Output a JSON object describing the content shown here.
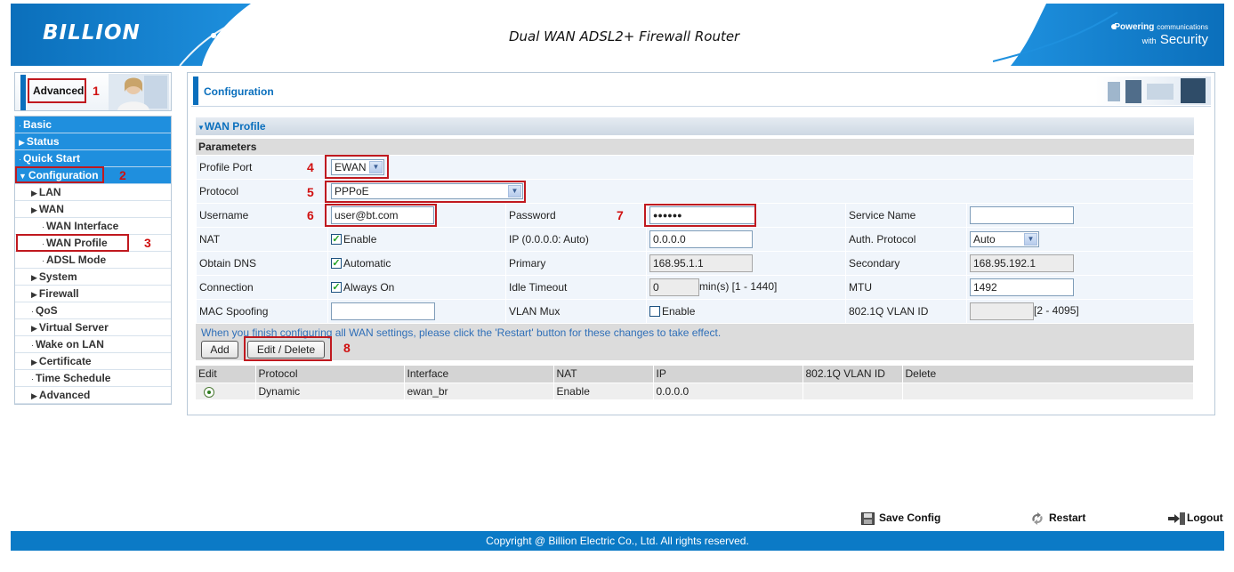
{
  "header": {
    "logo": "BILLION",
    "router_title": "Dual WAN ADSL2+ Firewall Router",
    "tagline_bold": "Powering",
    "tagline_small": "communications",
    "tagline_with": "with",
    "tagline_big": "Security"
  },
  "sidebar": {
    "mode_label": "Advanced",
    "items": [
      {
        "label": "Basic"
      },
      {
        "label": "Status"
      },
      {
        "label": "Quick Start"
      },
      {
        "label": "Configuration"
      },
      {
        "label": "LAN"
      },
      {
        "label": "WAN"
      },
      {
        "label": "WAN Interface"
      },
      {
        "label": "WAN Profile"
      },
      {
        "label": "ADSL Mode"
      },
      {
        "label": "System"
      },
      {
        "label": "Firewall"
      },
      {
        "label": "QoS"
      },
      {
        "label": "Virtual Server"
      },
      {
        "label": "Wake on LAN"
      },
      {
        "label": "Certificate"
      },
      {
        "label": "Time Schedule"
      },
      {
        "label": "Advanced"
      }
    ]
  },
  "content": {
    "title": "Configuration",
    "section_title": "WAN Profile",
    "params_title": "Parameters",
    "form": {
      "profile_port_label": "Profile Port",
      "profile_port_value": "EWAN",
      "protocol_label": "Protocol",
      "protocol_value": "PPPoE",
      "username_label": "Username",
      "username_value": "user@bt.com",
      "password_label": "Password",
      "password_value": "●●●●●●",
      "service_name_label": "Service Name",
      "service_name_value": "",
      "nat_label": "NAT",
      "nat_check": "Enable",
      "ip_label": "IP (0.0.0.0: Auto)",
      "ip_value": "0.0.0.0",
      "auth_label": "Auth. Protocol",
      "auth_value": "Auto",
      "obtain_dns_label": "Obtain DNS",
      "obtain_dns_check": "Automatic",
      "primary_label": "Primary",
      "primary_value": "168.95.1.1",
      "secondary_label": "Secondary",
      "secondary_value": "168.95.192.1",
      "connection_label": "Connection",
      "connection_check": "Always On",
      "idle_label": "Idle Timeout",
      "idle_value": "0",
      "idle_unit": "min(s) [1 - 1440]",
      "mtu_label": "MTU",
      "mtu_value": "1492",
      "mac_label": "MAC Spoofing",
      "mac_value": "",
      "vlan_mux_label": "VLAN Mux",
      "vlan_mux_check": "Enable",
      "vlan_id_label": "802.1Q VLAN ID",
      "vlan_id_value": "",
      "vlan_id_range": "[2 - 4095]"
    },
    "note": "When you finish configuring all WAN settings, please click the 'Restart' button for these changes to take effect.",
    "add_button": "Add",
    "edit_button": "Edit / Delete",
    "table": {
      "headers": [
        "Edit",
        "Protocol",
        "Interface",
        "NAT",
        "IP",
        "802.1Q VLAN ID",
        "Delete"
      ],
      "rows": [
        {
          "protocol": "Dynamic",
          "interface": "ewan_br",
          "nat": "Enable",
          "ip": "0.0.0.0",
          "vlan": "",
          "delete": ""
        }
      ]
    }
  },
  "annotations": [
    "1",
    "2",
    "3",
    "4",
    "5",
    "6",
    "7",
    "8"
  ],
  "footer": {
    "save_config": "Save Config",
    "restart": "Restart",
    "logout": "Logout",
    "copyright": "Copyright @ Billion Electric Co., Ltd. All rights reserved."
  },
  "colors": {
    "brand_blue": "#0b7ac6",
    "nav_blue": "#1f8fde",
    "annotation_red": "#c0191f"
  }
}
